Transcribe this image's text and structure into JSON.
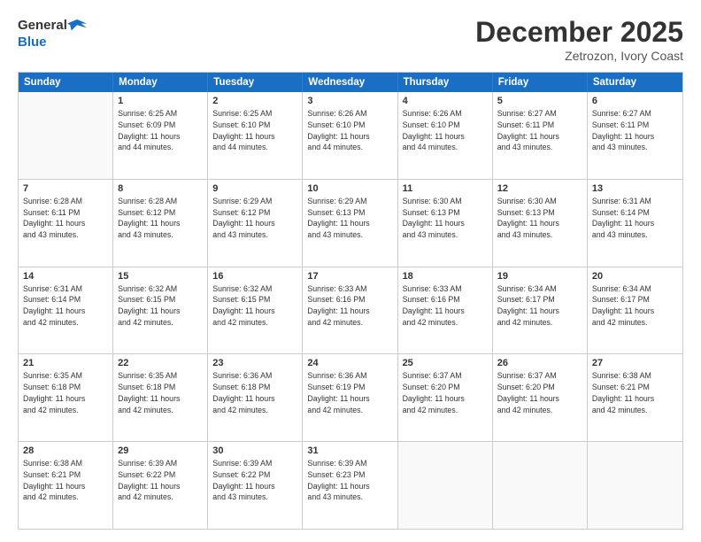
{
  "header": {
    "logo_general": "General",
    "logo_blue": "Blue",
    "month_title": "December 2025",
    "subtitle": "Zetrozon, Ivory Coast"
  },
  "days_of_week": [
    "Sunday",
    "Monday",
    "Tuesday",
    "Wednesday",
    "Thursday",
    "Friday",
    "Saturday"
  ],
  "weeks": [
    [
      {
        "day": "",
        "info": ""
      },
      {
        "day": "1",
        "info": "Sunrise: 6:25 AM\nSunset: 6:09 PM\nDaylight: 11 hours\nand 44 minutes."
      },
      {
        "day": "2",
        "info": "Sunrise: 6:25 AM\nSunset: 6:10 PM\nDaylight: 11 hours\nand 44 minutes."
      },
      {
        "day": "3",
        "info": "Sunrise: 6:26 AM\nSunset: 6:10 PM\nDaylight: 11 hours\nand 44 minutes."
      },
      {
        "day": "4",
        "info": "Sunrise: 6:26 AM\nSunset: 6:10 PM\nDaylight: 11 hours\nand 44 minutes."
      },
      {
        "day": "5",
        "info": "Sunrise: 6:27 AM\nSunset: 6:11 PM\nDaylight: 11 hours\nand 43 minutes."
      },
      {
        "day": "6",
        "info": "Sunrise: 6:27 AM\nSunset: 6:11 PM\nDaylight: 11 hours\nand 43 minutes."
      }
    ],
    [
      {
        "day": "7",
        "info": "Sunrise: 6:28 AM\nSunset: 6:11 PM\nDaylight: 11 hours\nand 43 minutes."
      },
      {
        "day": "8",
        "info": "Sunrise: 6:28 AM\nSunset: 6:12 PM\nDaylight: 11 hours\nand 43 minutes."
      },
      {
        "day": "9",
        "info": "Sunrise: 6:29 AM\nSunset: 6:12 PM\nDaylight: 11 hours\nand 43 minutes."
      },
      {
        "day": "10",
        "info": "Sunrise: 6:29 AM\nSunset: 6:13 PM\nDaylight: 11 hours\nand 43 minutes."
      },
      {
        "day": "11",
        "info": "Sunrise: 6:30 AM\nSunset: 6:13 PM\nDaylight: 11 hours\nand 43 minutes."
      },
      {
        "day": "12",
        "info": "Sunrise: 6:30 AM\nSunset: 6:13 PM\nDaylight: 11 hours\nand 43 minutes."
      },
      {
        "day": "13",
        "info": "Sunrise: 6:31 AM\nSunset: 6:14 PM\nDaylight: 11 hours\nand 43 minutes."
      }
    ],
    [
      {
        "day": "14",
        "info": "Sunrise: 6:31 AM\nSunset: 6:14 PM\nDaylight: 11 hours\nand 42 minutes."
      },
      {
        "day": "15",
        "info": "Sunrise: 6:32 AM\nSunset: 6:15 PM\nDaylight: 11 hours\nand 42 minutes."
      },
      {
        "day": "16",
        "info": "Sunrise: 6:32 AM\nSunset: 6:15 PM\nDaylight: 11 hours\nand 42 minutes."
      },
      {
        "day": "17",
        "info": "Sunrise: 6:33 AM\nSunset: 6:16 PM\nDaylight: 11 hours\nand 42 minutes."
      },
      {
        "day": "18",
        "info": "Sunrise: 6:33 AM\nSunset: 6:16 PM\nDaylight: 11 hours\nand 42 minutes."
      },
      {
        "day": "19",
        "info": "Sunrise: 6:34 AM\nSunset: 6:17 PM\nDaylight: 11 hours\nand 42 minutes."
      },
      {
        "day": "20",
        "info": "Sunrise: 6:34 AM\nSunset: 6:17 PM\nDaylight: 11 hours\nand 42 minutes."
      }
    ],
    [
      {
        "day": "21",
        "info": "Sunrise: 6:35 AM\nSunset: 6:18 PM\nDaylight: 11 hours\nand 42 minutes."
      },
      {
        "day": "22",
        "info": "Sunrise: 6:35 AM\nSunset: 6:18 PM\nDaylight: 11 hours\nand 42 minutes."
      },
      {
        "day": "23",
        "info": "Sunrise: 6:36 AM\nSunset: 6:18 PM\nDaylight: 11 hours\nand 42 minutes."
      },
      {
        "day": "24",
        "info": "Sunrise: 6:36 AM\nSunset: 6:19 PM\nDaylight: 11 hours\nand 42 minutes."
      },
      {
        "day": "25",
        "info": "Sunrise: 6:37 AM\nSunset: 6:20 PM\nDaylight: 11 hours\nand 42 minutes."
      },
      {
        "day": "26",
        "info": "Sunrise: 6:37 AM\nSunset: 6:20 PM\nDaylight: 11 hours\nand 42 minutes."
      },
      {
        "day": "27",
        "info": "Sunrise: 6:38 AM\nSunset: 6:21 PM\nDaylight: 11 hours\nand 42 minutes."
      }
    ],
    [
      {
        "day": "28",
        "info": "Sunrise: 6:38 AM\nSunset: 6:21 PM\nDaylight: 11 hours\nand 42 minutes."
      },
      {
        "day": "29",
        "info": "Sunrise: 6:39 AM\nSunset: 6:22 PM\nDaylight: 11 hours\nand 42 minutes."
      },
      {
        "day": "30",
        "info": "Sunrise: 6:39 AM\nSunset: 6:22 PM\nDaylight: 11 hours\nand 43 minutes."
      },
      {
        "day": "31",
        "info": "Sunrise: 6:39 AM\nSunset: 6:23 PM\nDaylight: 11 hours\nand 43 minutes."
      },
      {
        "day": "",
        "info": ""
      },
      {
        "day": "",
        "info": ""
      },
      {
        "day": "",
        "info": ""
      }
    ]
  ]
}
